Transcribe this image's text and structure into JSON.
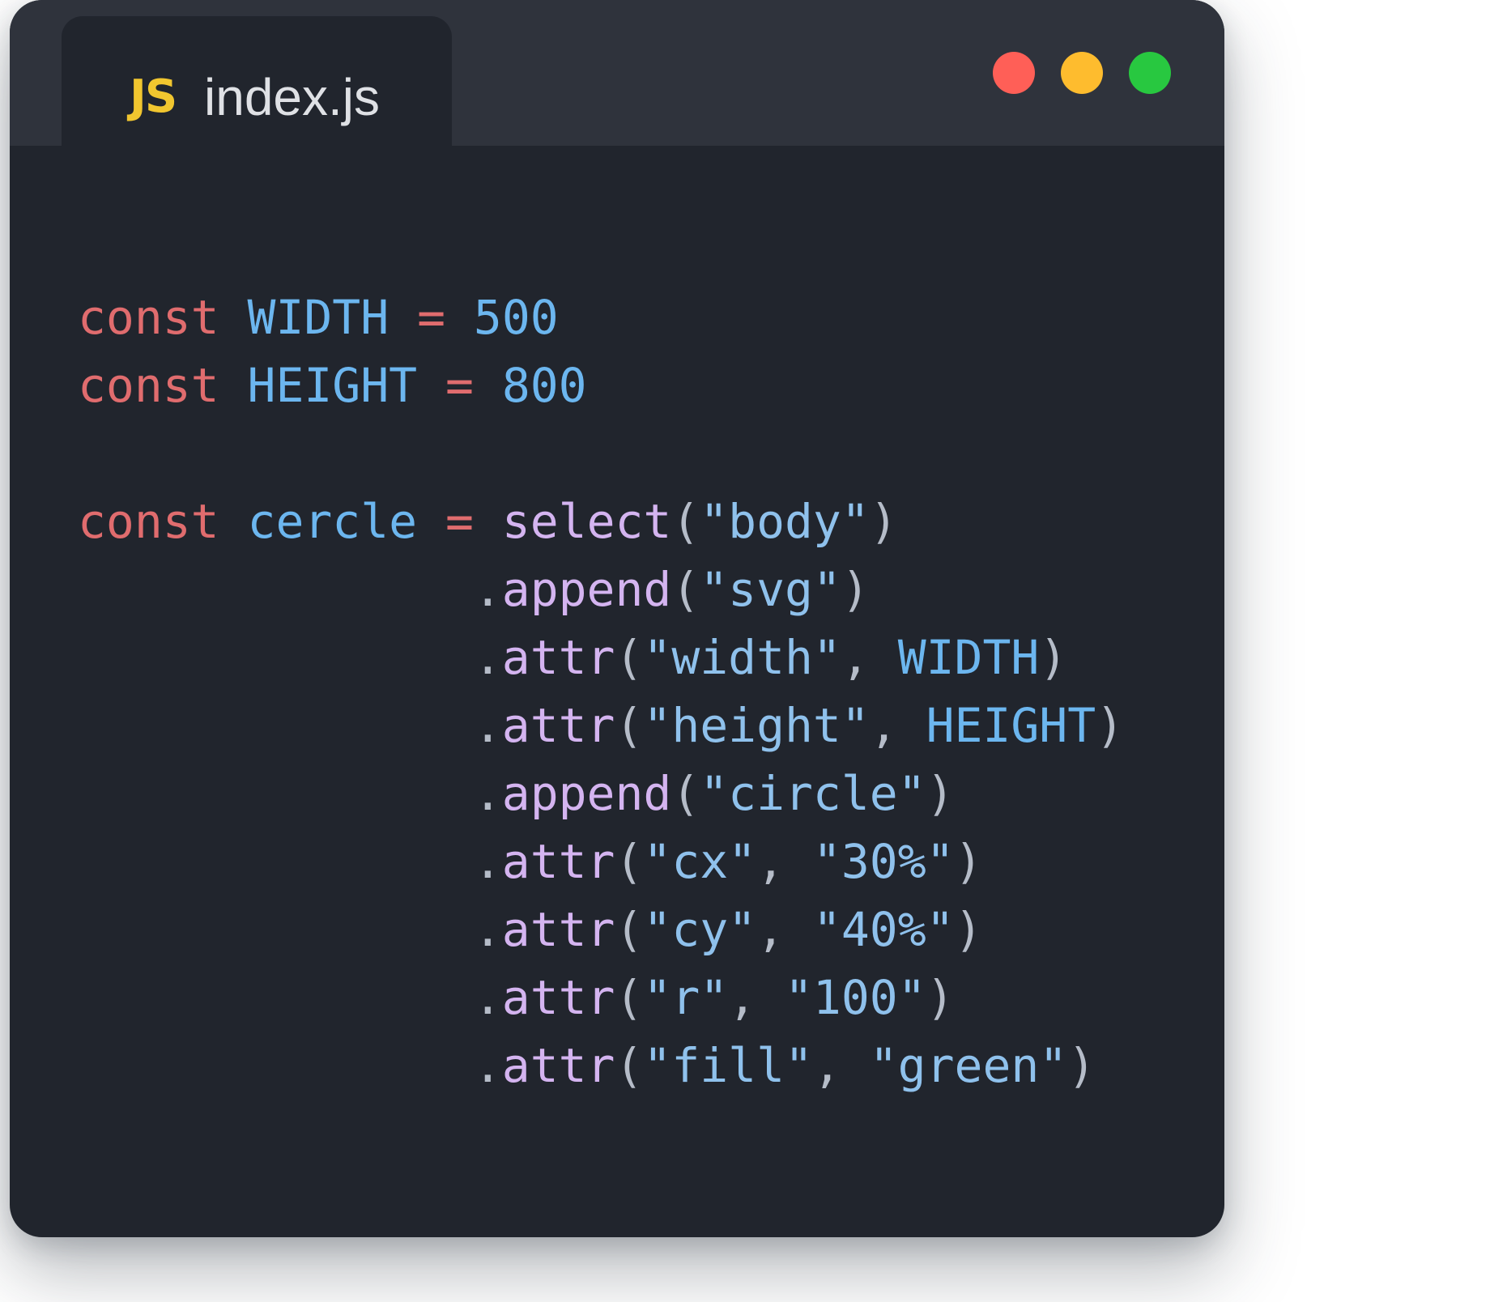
{
  "colors": {
    "window_bg": "#21252d",
    "titlebar_bg": "#2f333c",
    "keyword": "#e06c6e",
    "variable": "#6cb6ef",
    "function": "#d4b4f0",
    "string": "#8fc1ec",
    "punctuation": "#b5bcc8",
    "js_badge": "#f1c62f",
    "traffic_close": "#ff5f57",
    "traffic_minimize": "#febc2e",
    "traffic_maximize": "#28c840"
  },
  "tab": {
    "icon": "js-icon",
    "icon_text": "JS",
    "label": "index.js"
  },
  "window_controls": [
    "close-button",
    "minimize-button",
    "maximize-button"
  ],
  "code": {
    "lines": [
      [
        {
          "t": "kw",
          "v": "const"
        },
        {
          "t": "pn",
          "v": " "
        },
        {
          "t": "var",
          "v": "WIDTH"
        },
        {
          "t": "pn",
          "v": " "
        },
        {
          "t": "op",
          "v": "="
        },
        {
          "t": "pn",
          "v": " "
        },
        {
          "t": "num",
          "v": "500"
        }
      ],
      [
        {
          "t": "kw",
          "v": "const"
        },
        {
          "t": "pn",
          "v": " "
        },
        {
          "t": "var",
          "v": "HEIGHT"
        },
        {
          "t": "pn",
          "v": " "
        },
        {
          "t": "op",
          "v": "="
        },
        {
          "t": "pn",
          "v": " "
        },
        {
          "t": "num",
          "v": "800"
        }
      ],
      [],
      [
        {
          "t": "kw",
          "v": "const"
        },
        {
          "t": "pn",
          "v": " "
        },
        {
          "t": "var",
          "v": "cercle"
        },
        {
          "t": "pn",
          "v": " "
        },
        {
          "t": "op",
          "v": "="
        },
        {
          "t": "pn",
          "v": " "
        },
        {
          "t": "fn",
          "v": "select"
        },
        {
          "t": "pn",
          "v": "("
        },
        {
          "t": "str",
          "v": "\"body\""
        },
        {
          "t": "pn",
          "v": ")"
        }
      ],
      [
        {
          "t": "pn",
          "v": "              ."
        },
        {
          "t": "fn",
          "v": "append"
        },
        {
          "t": "pn",
          "v": "("
        },
        {
          "t": "str",
          "v": "\"svg\""
        },
        {
          "t": "pn",
          "v": ")"
        }
      ],
      [
        {
          "t": "pn",
          "v": "              ."
        },
        {
          "t": "fn",
          "v": "attr"
        },
        {
          "t": "pn",
          "v": "("
        },
        {
          "t": "str",
          "v": "\"width\""
        },
        {
          "t": "pn",
          "v": ", "
        },
        {
          "t": "var",
          "v": "WIDTH"
        },
        {
          "t": "pn",
          "v": ")"
        }
      ],
      [
        {
          "t": "pn",
          "v": "              ."
        },
        {
          "t": "fn",
          "v": "attr"
        },
        {
          "t": "pn",
          "v": "("
        },
        {
          "t": "str",
          "v": "\"height\""
        },
        {
          "t": "pn",
          "v": ", "
        },
        {
          "t": "var",
          "v": "HEIGHT"
        },
        {
          "t": "pn",
          "v": ")"
        }
      ],
      [
        {
          "t": "pn",
          "v": "              ."
        },
        {
          "t": "fn",
          "v": "append"
        },
        {
          "t": "pn",
          "v": "("
        },
        {
          "t": "str",
          "v": "\"circle\""
        },
        {
          "t": "pn",
          "v": ")"
        }
      ],
      [
        {
          "t": "pn",
          "v": "              ."
        },
        {
          "t": "fn",
          "v": "attr"
        },
        {
          "t": "pn",
          "v": "("
        },
        {
          "t": "str",
          "v": "\"cx\""
        },
        {
          "t": "pn",
          "v": ", "
        },
        {
          "t": "str",
          "v": "\"30%\""
        },
        {
          "t": "pn",
          "v": ")"
        }
      ],
      [
        {
          "t": "pn",
          "v": "              ."
        },
        {
          "t": "fn",
          "v": "attr"
        },
        {
          "t": "pn",
          "v": "("
        },
        {
          "t": "str",
          "v": "\"cy\""
        },
        {
          "t": "pn",
          "v": ", "
        },
        {
          "t": "str",
          "v": "\"40%\""
        },
        {
          "t": "pn",
          "v": ")"
        }
      ],
      [
        {
          "t": "pn",
          "v": "              ."
        },
        {
          "t": "fn",
          "v": "attr"
        },
        {
          "t": "pn",
          "v": "("
        },
        {
          "t": "str",
          "v": "\"r\""
        },
        {
          "t": "pn",
          "v": ", "
        },
        {
          "t": "str",
          "v": "\"100\""
        },
        {
          "t": "pn",
          "v": ")"
        }
      ],
      [
        {
          "t": "pn",
          "v": "              ."
        },
        {
          "t": "fn",
          "v": "attr"
        },
        {
          "t": "pn",
          "v": "("
        },
        {
          "t": "str",
          "v": "\"fill\""
        },
        {
          "t": "pn",
          "v": ", "
        },
        {
          "t": "str",
          "v": "\"green\""
        },
        {
          "t": "pn",
          "v": ")"
        }
      ]
    ]
  }
}
